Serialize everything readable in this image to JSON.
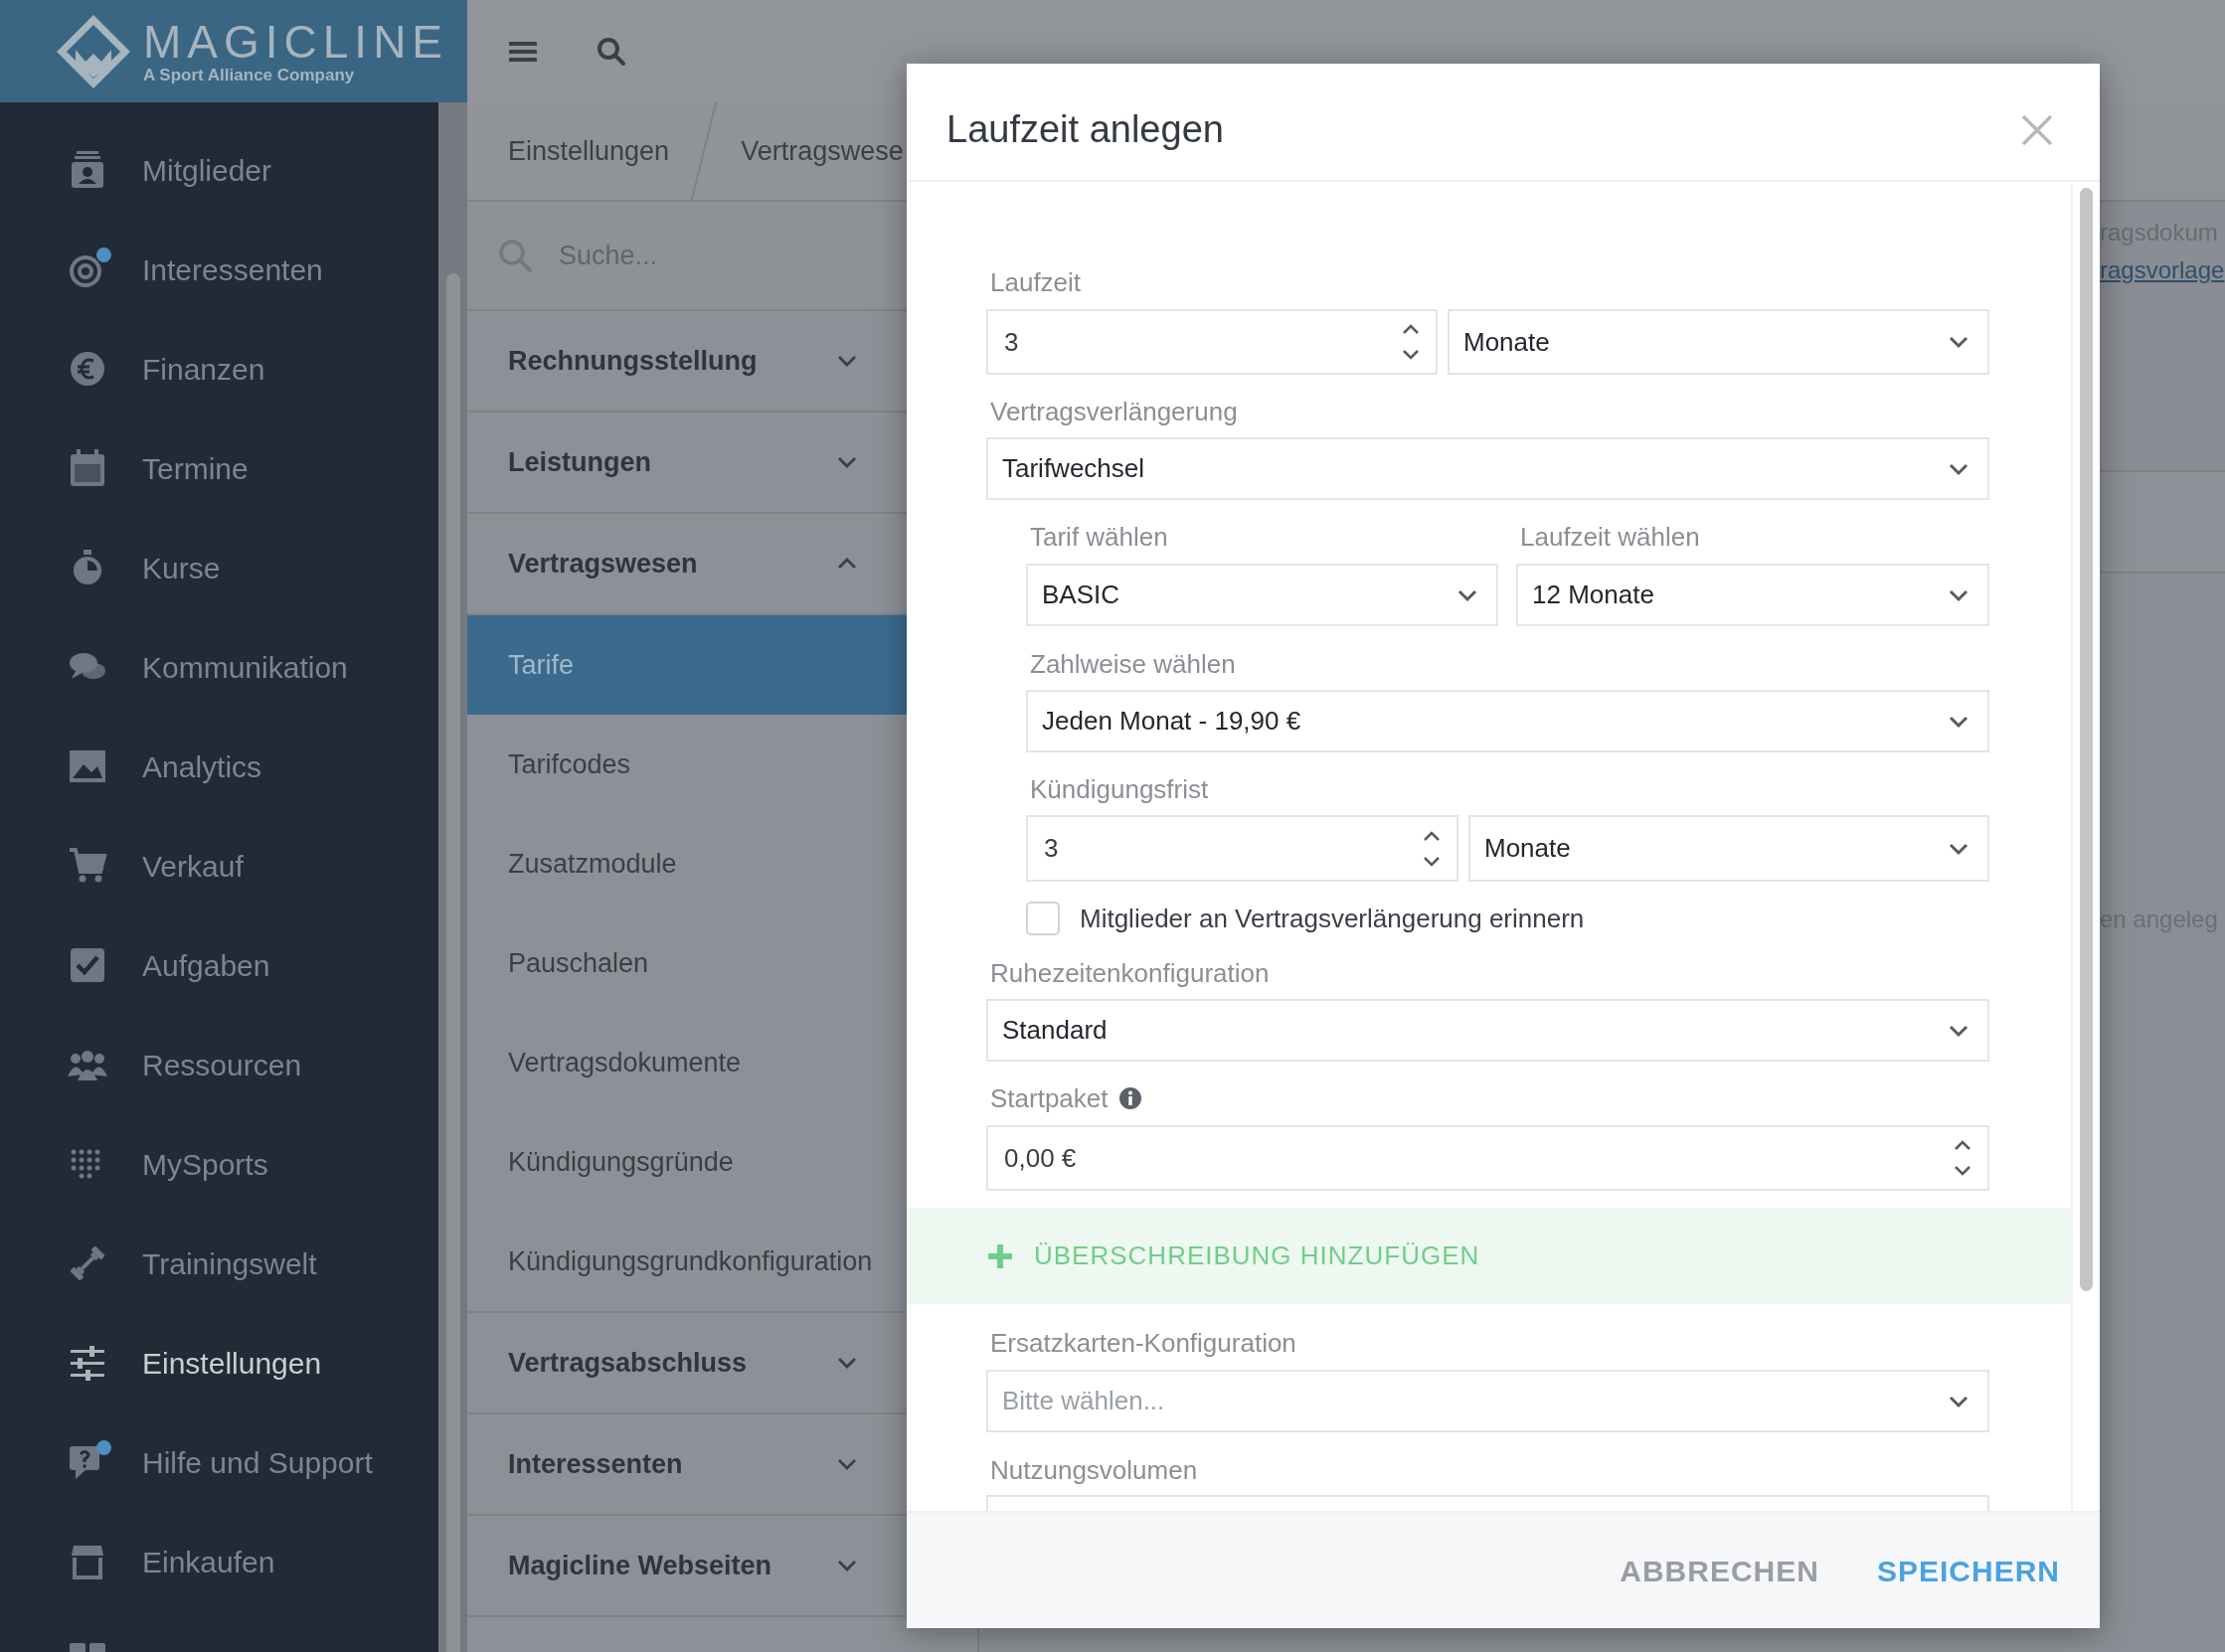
{
  "logo": {
    "name": "MAGICLINE",
    "tagline": "A Sport Alliance Company"
  },
  "sidebar": {
    "items": [
      {
        "label": "Mitglieder",
        "selected": false,
        "notification": false
      },
      {
        "label": "Interessenten",
        "selected": false,
        "notification": true
      },
      {
        "label": "Finanzen",
        "selected": false,
        "notification": false
      },
      {
        "label": "Termine",
        "selected": false,
        "notification": false
      },
      {
        "label": "Kurse",
        "selected": false,
        "notification": false
      },
      {
        "label": "Kommunikation",
        "selected": false,
        "notification": false
      },
      {
        "label": "Analytics",
        "selected": false,
        "notification": false
      },
      {
        "label": "Verkauf",
        "selected": false,
        "notification": false
      },
      {
        "label": "Aufgaben",
        "selected": false,
        "notification": false
      },
      {
        "label": "Ressourcen",
        "selected": false,
        "notification": false
      },
      {
        "label": "MySports",
        "selected": false,
        "notification": false
      },
      {
        "label": "Trainingswelt",
        "selected": false,
        "notification": false
      },
      {
        "label": "Einstellungen",
        "selected": true,
        "notification": false
      },
      {
        "label": "Hilfe und Support",
        "selected": false,
        "notification": true
      },
      {
        "label": "Einkaufen",
        "selected": false,
        "notification": false
      }
    ]
  },
  "settings_panel": {
    "breadcrumb": [
      "Einstellungen",
      "Vertragswese"
    ],
    "search": {
      "placeholder": "Suche..."
    },
    "sections": [
      {
        "label": "Rechnungsstellung",
        "expanded": false
      },
      {
        "label": "Leistungen",
        "expanded": false
      },
      {
        "label": "Vertragswesen",
        "expanded": true,
        "children": [
          {
            "label": "Tarife",
            "selected": true
          },
          {
            "label": "Tarifcodes",
            "selected": false
          },
          {
            "label": "Zusatzmodule",
            "selected": false
          },
          {
            "label": "Pauschalen",
            "selected": false
          },
          {
            "label": "Vertragsdokumente",
            "selected": false
          },
          {
            "label": "Kündigungsgründe",
            "selected": false
          },
          {
            "label": "Kündigungsgrundkonfiguration",
            "selected": false
          }
        ]
      },
      {
        "label": "Vertragsabschluss",
        "expanded": false
      },
      {
        "label": "Interessenten",
        "expanded": false
      },
      {
        "label": "Magicline Webseiten",
        "expanded": false
      }
    ]
  },
  "background": {
    "text_1": "ragsdokum",
    "link": "ragsvorlage",
    "text_2": "en angeleg"
  },
  "dialog": {
    "title": "Laufzeit anlegen",
    "laufzeit": {
      "label": "Laufzeit",
      "value": "3",
      "unit": "Monate"
    },
    "verlaengerung": {
      "label": "Vertragsverlängerung",
      "value": "Tarifwechsel"
    },
    "tarif": {
      "label": "Tarif wählen",
      "value": "BASIC"
    },
    "laufzeit_waehlen": {
      "label": "Laufzeit wählen",
      "value": "12 Monate"
    },
    "zahlweise": {
      "label": "Zahlweise wählen",
      "value": "Jeden Monat - 19,90 €"
    },
    "kuendigungsfrist": {
      "label": "Kündigungsfrist",
      "value": "3",
      "unit": "Monate"
    },
    "reminder": {
      "label": "Mitglieder an Vertragsverlängerung erinnern",
      "checked": false
    },
    "ruhezeiten": {
      "label": "Ruhezeitenkonfiguration",
      "value": "Standard"
    },
    "startpaket": {
      "label": "Startpaket",
      "value": "0,00 €"
    },
    "add_override": "ÜBERSCHREIBUNG HINZUFÜGEN",
    "ersatzkarten": {
      "label": "Ersatzkarten-Konfiguration",
      "placeholder": "Bitte wählen..."
    },
    "nutzungsvolumen": {
      "label": "Nutzungsvolumen"
    },
    "buttons": [
      {
        "label": "ABBRECHEN",
        "kind": "secondary"
      },
      {
        "label": "SPEICHERN",
        "kind": "primary"
      }
    ]
  }
}
